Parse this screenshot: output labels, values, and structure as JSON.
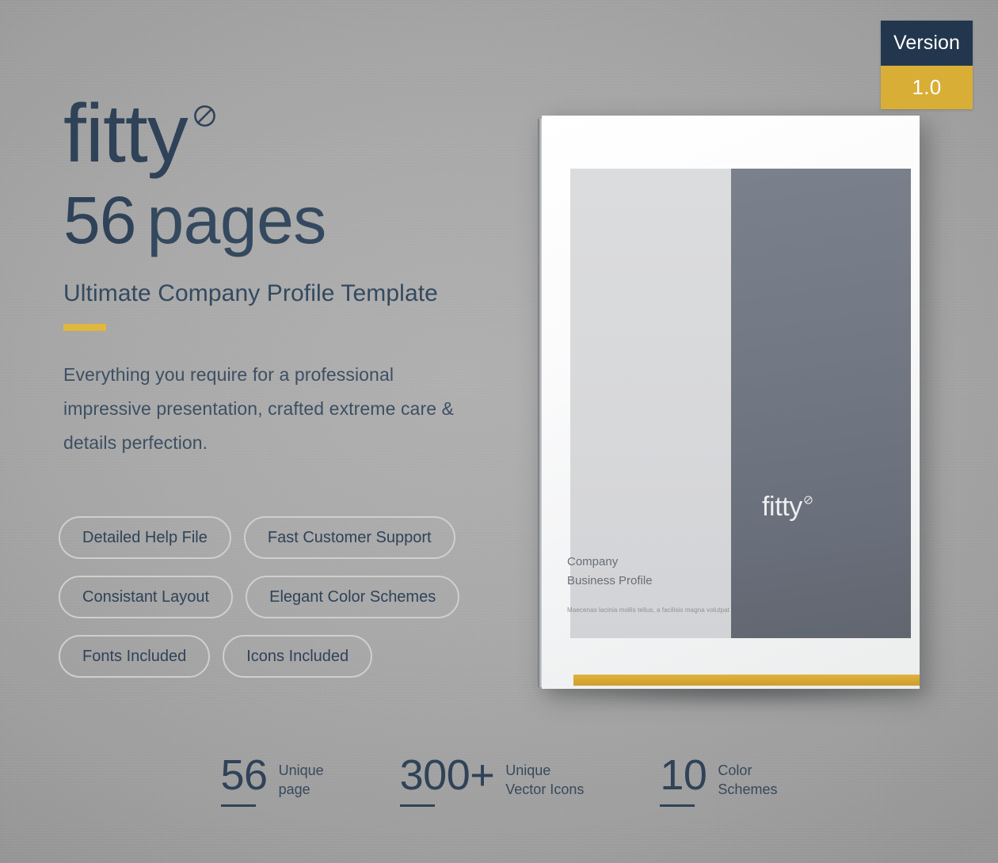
{
  "theme": {
    "background": "#a8a8a8",
    "navy": "#22374e",
    "gold": "#d9ae36",
    "text_dark": "#2f4258",
    "pill_border": "#cfcfcf"
  },
  "version_badge": {
    "label": "Version",
    "value": "1.0"
  },
  "hero": {
    "logo_word": "fitty",
    "logo_mark_icon": "circle-slash-icon",
    "pages_number": "56",
    "pages_word": "pages",
    "subtitle": "Ultimate Company Profile Template",
    "blurb": "Everything you require for a professional impressive presentation, crafted extreme care & details perfection."
  },
  "features": {
    "rows": [
      [
        {
          "label": "Detailed Help File"
        },
        {
          "label": "Fast Customer Support"
        }
      ],
      [
        {
          "label": "Consistant Layout"
        },
        {
          "label": "Elegant Color Schemes"
        }
      ],
      [
        {
          "label": "Fonts Included"
        },
        {
          "label": "Icons Included"
        }
      ]
    ]
  },
  "stats": [
    {
      "number": "56",
      "label": "Unique\npage"
    },
    {
      "number": "300+",
      "label": "Unique\nVector Icons"
    },
    {
      "number": "10",
      "label": "Color\nSchemes"
    }
  ],
  "brochure": {
    "logo_word": "fitty",
    "logo_mark_icon": "circle-slash-icon",
    "title_line_1": "Company",
    "title_line_2": "Business Profile",
    "caption": "Maecenas lacinia mollis tellus, a facilisis magna volutpat",
    "accent_color": "#d6a733"
  }
}
